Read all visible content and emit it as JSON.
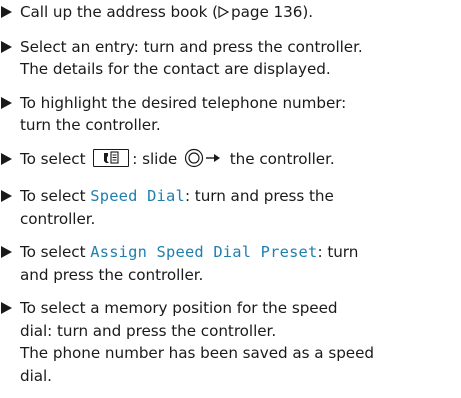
{
  "steps": [
    {
      "pre": "Call up the address book (",
      "ref": "page 136",
      "post": ")."
    },
    {
      "line1": "Select an entry: turn and press the controller.",
      "line2": "The details for the contact are displayed."
    },
    {
      "line1": "To highlight the desired telephone number:",
      "line2": "turn the controller."
    },
    {
      "pre": "To select",
      "mid": ": slide",
      "post": "the controller."
    },
    {
      "pre": "To select",
      "option": "Speed Dial",
      "line1_post": ": turn and press the",
      "line2": "controller."
    },
    {
      "pre": "To select",
      "option": "Assign Speed Dial Preset",
      "line1_post": ": turn",
      "line2": "and press the controller."
    },
    {
      "line1": "To select a memory position for the speed",
      "line2": "dial: turn and press the controller.",
      "line3": "The phone number has been saved as a speed",
      "line4": "dial."
    }
  ],
  "icons": {
    "bullet": "triangle-bullet-icon",
    "page_ref": "page-reference-triangle-icon",
    "menu_key": "phone-menu-key-icon",
    "controller_slide": "controller-slide-right-icon"
  },
  "colors": {
    "option_highlight": "#1f7fb0",
    "text": "#1a1a1a"
  }
}
